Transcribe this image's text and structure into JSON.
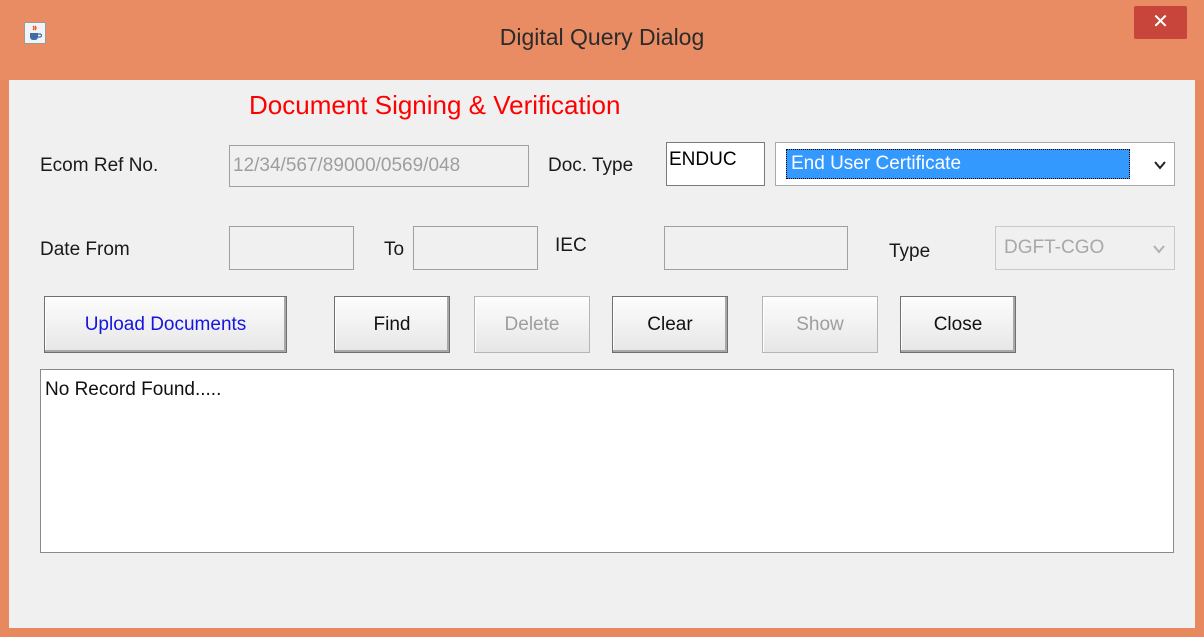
{
  "window": {
    "title": "Digital Query Dialog",
    "close_glyph": "✕",
    "app_icon": "java-cup-icon"
  },
  "heading": "Document Signing &  Verification",
  "form": {
    "ecom_ref": {
      "label": "Ecom Ref No.",
      "value": "12/34/567/89000/0569/048"
    },
    "doc_type": {
      "label": "Doc. Type",
      "code": "ENDUC",
      "selected": "End User Certificate"
    },
    "date_from": {
      "label": "Date From",
      "value": ""
    },
    "date_to": {
      "label": "To",
      "value": ""
    },
    "iec": {
      "label": "IEC",
      "value": ""
    },
    "type": {
      "label": "Type",
      "selected": "DGFT-CGO"
    }
  },
  "buttons": {
    "upload": "Upload Documents",
    "find": "Find",
    "delete": "Delete",
    "clear": "Clear",
    "show": "Show",
    "close": "Close"
  },
  "results": {
    "message": "No Record Found....."
  },
  "colors": {
    "frame": "#e8885f",
    "close_button": "#c7453a",
    "heading": "#ff0000",
    "selection": "#3399ff",
    "link_button_text": "#1515e0"
  }
}
